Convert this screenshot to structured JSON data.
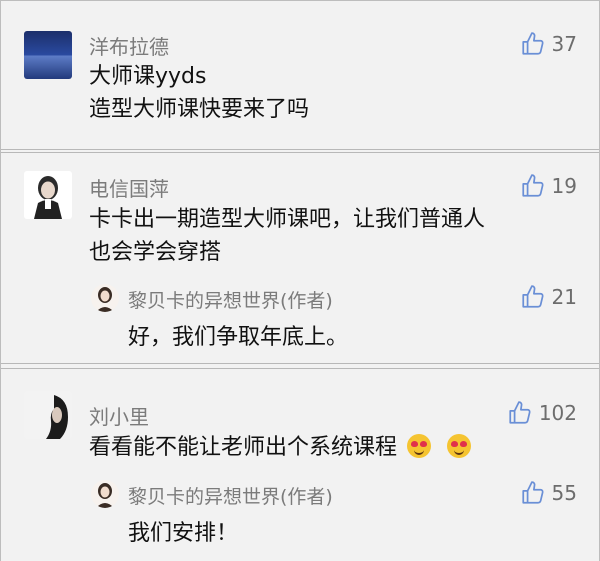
{
  "comments": [
    {
      "user": "洋布拉德",
      "likes": "37",
      "lines": [
        "大师课yyds",
        "造型大师课快要来了吗"
      ]
    },
    {
      "user": "电信国萍",
      "likes": "19",
      "lines": [
        "卡卡出一期造型大师课吧，让我们普通人",
        "也会学会穿搭"
      ],
      "reply": {
        "user": "黎贝卡的异想世界(作者)",
        "likes": "21",
        "text": "好，我们争取年底上。"
      }
    },
    {
      "user": "刘小里",
      "likes": "102",
      "lines": [
        "看看能不能让老师出个系统课程"
      ],
      "emojis": [
        "heart-eyes-emoji",
        "heart-eyes-emoji"
      ],
      "reply": {
        "user": "黎贝卡的异想世界(作者)",
        "likes": "55",
        "text": "我们安排！"
      }
    }
  ],
  "icons": {
    "like": "thumbs-up-icon"
  },
  "colors": {
    "background": "#f2f2f2",
    "name": "#7b7b7b",
    "text": "#111111",
    "divider": "#b8b8b8"
  }
}
